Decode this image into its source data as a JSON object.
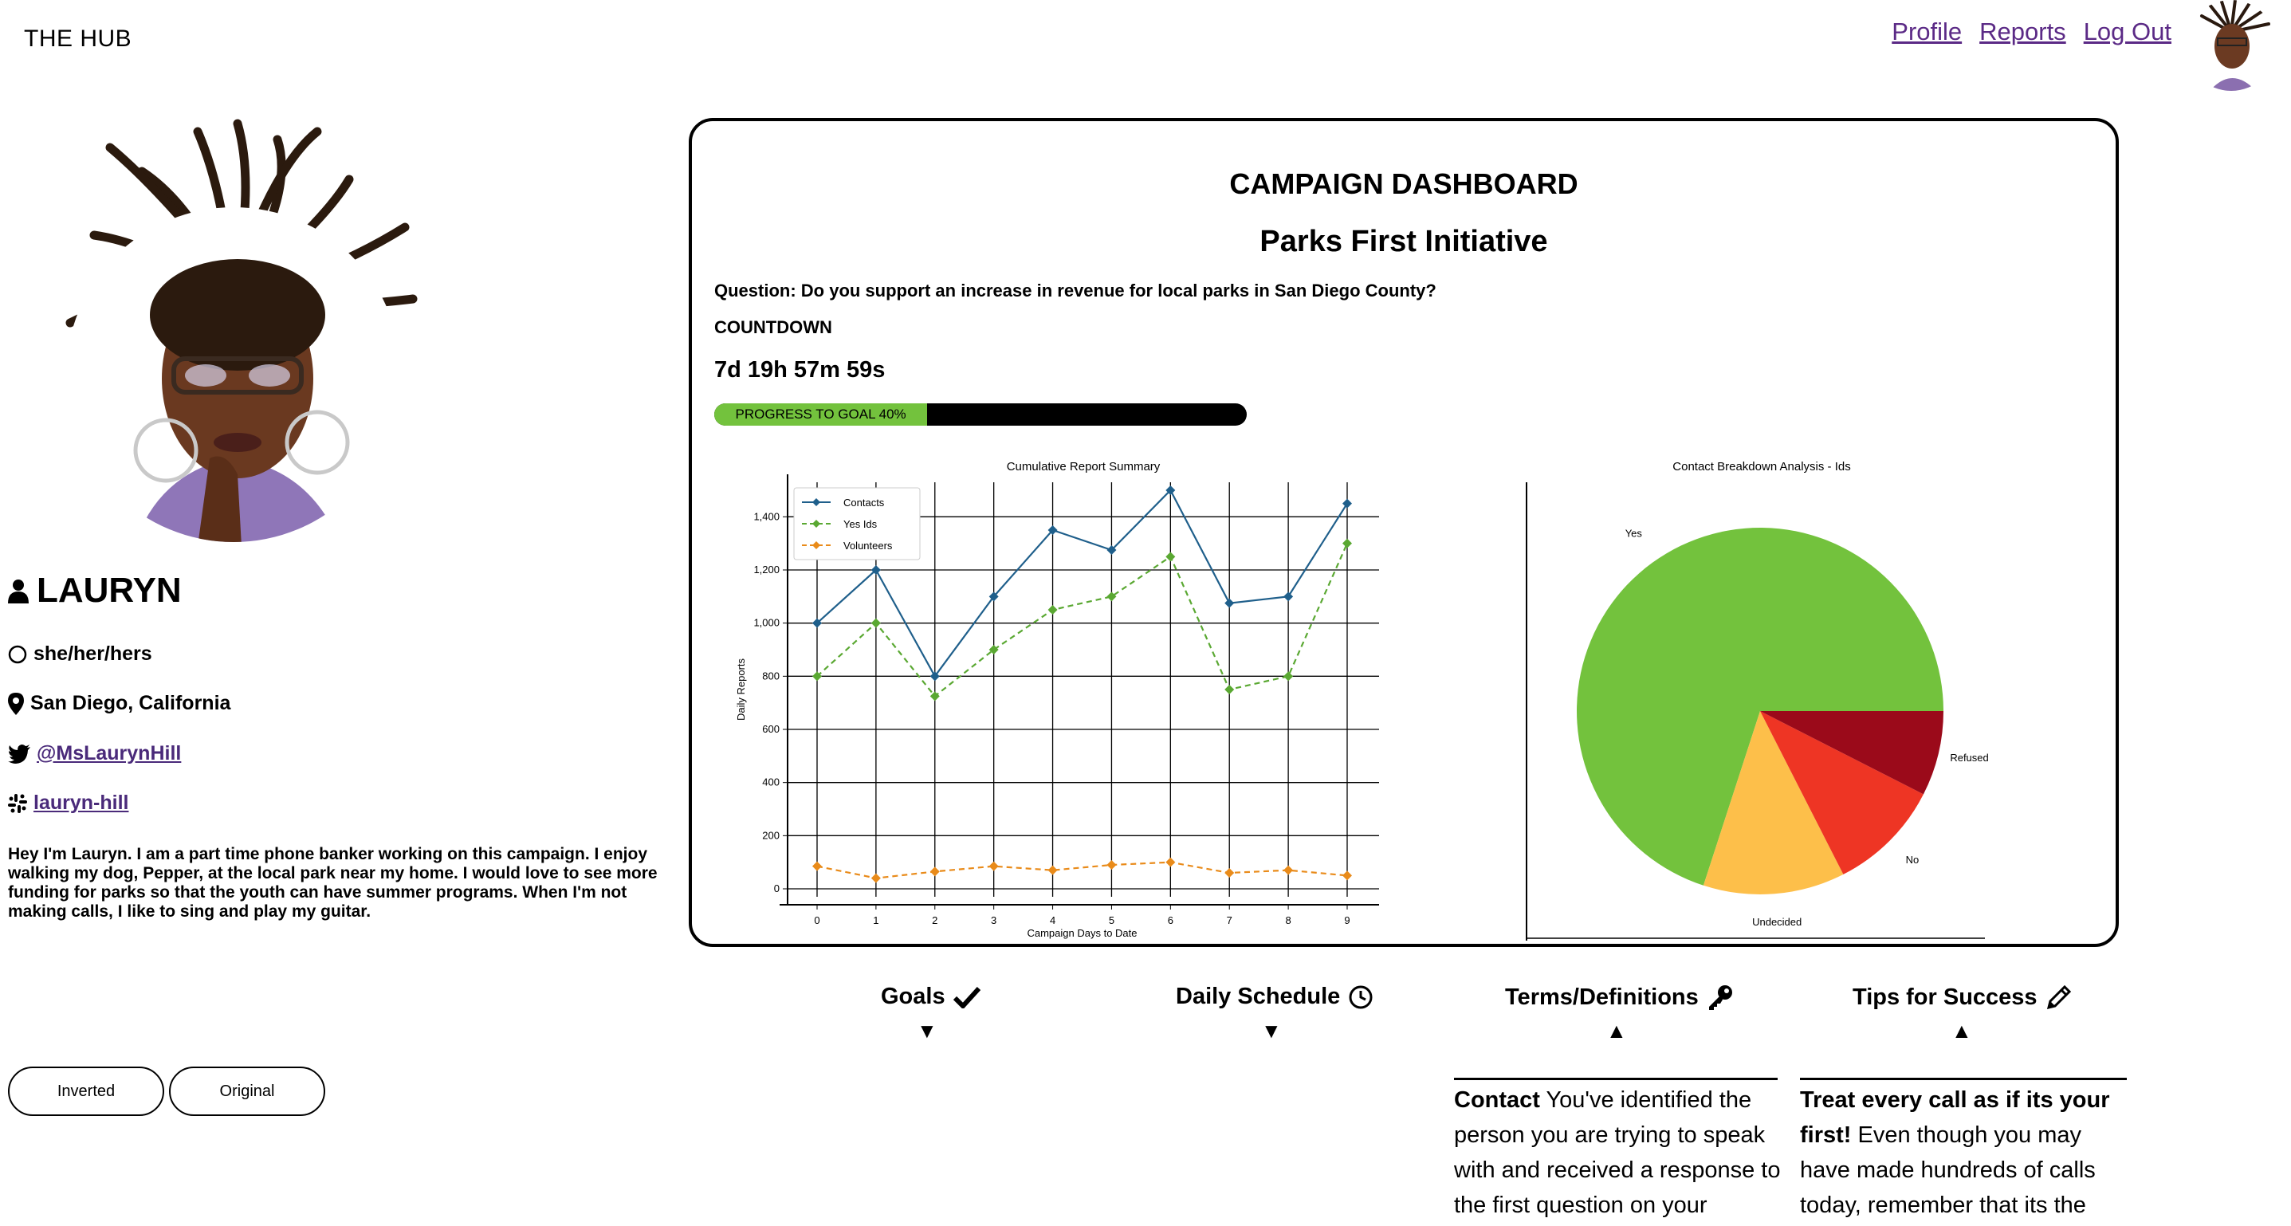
{
  "header": {
    "brand": "THE HUB",
    "nav": [
      "Profile",
      "Reports",
      "Log Out"
    ]
  },
  "profile": {
    "name": "LAURYN",
    "pronouns": "she/her/hers",
    "location": "San Diego, California",
    "twitter": "@MsLaurynHill",
    "slack": "lauryn-hill",
    "bio": "Hey I'm Lauryn. I am a part time phone banker working on this campaign. I enjoy walking my dog, Pepper, at the local park near my home. I would love to see more funding for parks so that the youth can have summer programs. When I'm not making calls, I like to sing and play my guitar."
  },
  "theme_buttons": [
    "Inverted",
    "Original"
  ],
  "dashboard": {
    "title": "CAMPAIGN DASHBOARD",
    "campaign": "Parks First Initiative",
    "question": "Question: Do you support an increase in revenue for local parks in San Diego County?",
    "countdown_label": "COUNTDOWN",
    "countdown_value": "7d 19h 57m 59s",
    "progress_label": "PROGRESS TO GOAL 40%",
    "progress_fraction": 0.4
  },
  "chart_data": [
    {
      "type": "line",
      "title": "Cumulative Report Summary",
      "xlabel": "Campaign Days to Date",
      "ylabel": "Daily Reports",
      "x": [
        0,
        1,
        2,
        3,
        4,
        5,
        6,
        7,
        8,
        9
      ],
      "ylim": [
        0,
        1500
      ],
      "yticks": [
        0,
        200,
        400,
        600,
        800,
        1000,
        1200,
        1400
      ],
      "ytick_labels": [
        "0",
        "200",
        "400",
        "600",
        "800",
        "1,000",
        "1,200",
        "1,400"
      ],
      "grid": true,
      "legend": "top-left",
      "series": [
        {
          "name": "Contacts",
          "color": "#1f5f8b",
          "dash": false,
          "values": [
            1000,
            1200,
            800,
            1100,
            1350,
            1275,
            1500,
            1075,
            1100,
            1450
          ]
        },
        {
          "name": "Yes Ids",
          "color": "#5aa832",
          "dash": true,
          "values": [
            800,
            1000,
            725,
            900,
            1050,
            1100,
            1250,
            750,
            800,
            1300
          ]
        },
        {
          "name": "Volunteers",
          "color": "#e98b1a",
          "dash": true,
          "values": [
            85,
            40,
            65,
            85,
            70,
            90,
            100,
            60,
            70,
            50
          ]
        }
      ]
    },
    {
      "type": "pie",
      "title": "Contact Breakdown Analysis - Ids",
      "slices": [
        {
          "label": "Yes",
          "value": 70,
          "color": "#73c23d"
        },
        {
          "label": "Undecided",
          "value": 12.5,
          "color": "#fdbf4a"
        },
        {
          "label": "No",
          "value": 10,
          "color": "#ee3524"
        },
        {
          "label": "Refused",
          "value": 7.5,
          "color": "#9b0a1a"
        }
      ]
    }
  ],
  "info_sections": [
    {
      "title": "Goals",
      "icon": "check-icon",
      "caret": "down"
    },
    {
      "title": "Daily Schedule",
      "icon": "clock-icon",
      "caret": "down"
    },
    {
      "title": "Terms/Definitions",
      "icon": "key-icon",
      "caret": "up",
      "bold": "Contact",
      "text": " You've identified the person you are trying to speak with and received a response to the first question on your"
    },
    {
      "title": "Tips for Success",
      "icon": "pencil-icon",
      "caret": "up",
      "bold": "Treat every call as if its your first!",
      "text": " Even though you may have made hundreds of calls today, remember that its the"
    }
  ]
}
